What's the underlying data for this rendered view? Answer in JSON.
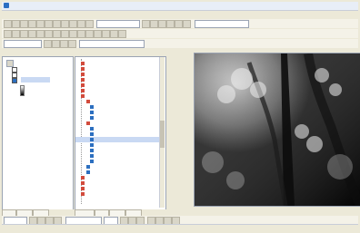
{
  "window": {
    "title": ""
  },
  "menubar": {
    "items": []
  },
  "toolbar": {
    "scale_value": "",
    "layer_select": ""
  },
  "toc": {
    "root": "",
    "layers": []
  },
  "catalog": {
    "items": []
  },
  "tabs": {
    "left": [],
    "middle": []
  },
  "status": {
    "left": "",
    "right": ""
  },
  "colors": {
    "tree_folder": "#d24b3c",
    "tree_tool": "#2c6fc0",
    "selection": "#c9d9f3"
  }
}
